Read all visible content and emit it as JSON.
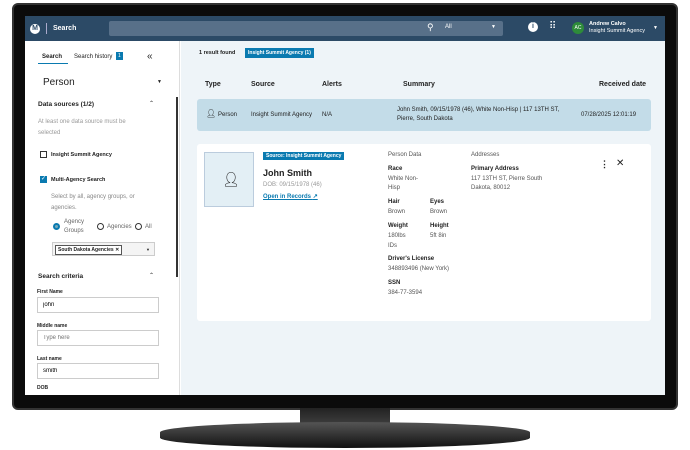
{
  "topbar": {
    "title": "Search",
    "search_placeholder": "",
    "search_scope": "All",
    "user_initials": "AC",
    "user_name": "Andrew Calvo",
    "user_agency": "Insight Summit Agency"
  },
  "sidebar": {
    "tabs": [
      {
        "label": "Search",
        "active": true
      },
      {
        "label": "Search history",
        "badge": "1"
      }
    ],
    "entity_type": "Person",
    "data_sources": {
      "title": "Data sources (1/2)",
      "hint": "At least one data source must be selected",
      "options": [
        {
          "label": "Insight Summit Agency",
          "checked": false
        },
        {
          "label": "Multi-Agency Search",
          "checked": true
        }
      ],
      "multi_hint": "Select by all, agency groups, or agencies.",
      "radios": [
        {
          "label": "Agency Groups",
          "selected": true
        },
        {
          "label": "Agencies",
          "selected": false
        },
        {
          "label": "All",
          "selected": false
        }
      ],
      "chip": "South Dakota Agencies"
    },
    "criteria": {
      "title": "Search criteria",
      "fields": [
        {
          "label": "First Name",
          "value": "john",
          "placeholder": ""
        },
        {
          "label": "Middle name",
          "value": "",
          "placeholder": "Type here"
        },
        {
          "label": "Last name",
          "value": "smith",
          "placeholder": ""
        },
        {
          "label": "DOB",
          "value": "",
          "placeholder": ""
        }
      ]
    }
  },
  "results": {
    "count_text": "1 result found",
    "filter_chip": "Insight Summit Agency (1)",
    "columns": [
      "Type",
      "Source",
      "Alerts",
      "Summary",
      "Received date"
    ],
    "rows": [
      {
        "type": "Person",
        "source": "Insight Summit Agency",
        "alerts": "N/A",
        "summary": "John Smith, 09/15/1978 (46), White Non-Hisp | 117 13TH ST, Pierre, South Dakota",
        "received": "07/28/2025 12:01:19"
      }
    ]
  },
  "detail": {
    "source_badge": "Source: Insight Summit Agency",
    "name": "John Smith",
    "dob": "DOB: 09/15/1978 (46)",
    "open_link": "Open in Records",
    "person_data_title": "Person Data",
    "race_label": "Race",
    "race": "White Non-Hisp",
    "hair_label": "Hair",
    "hair": "Brown",
    "eyes_label": "Eyes",
    "eyes": "Brown",
    "weight_label": "Weight",
    "weight": "180lbs",
    "height_label": "Height",
    "height": "5ft 8in",
    "ids_title": "IDs",
    "dl_label": "Driver's License",
    "dl": "348893496 (New York)",
    "ssn_label": "SSN",
    "ssn": "384-77-3594",
    "addresses_title": "Addresses",
    "primary_label": "Primary Address",
    "primary": "117 13TH ST, Pierre South Dakota, 80012"
  },
  "colors": {
    "topbar": "#2c4a66",
    "accent": "#0a7ab0",
    "row_selected": "#c3dce8",
    "avatar": "#2e8b3a"
  }
}
